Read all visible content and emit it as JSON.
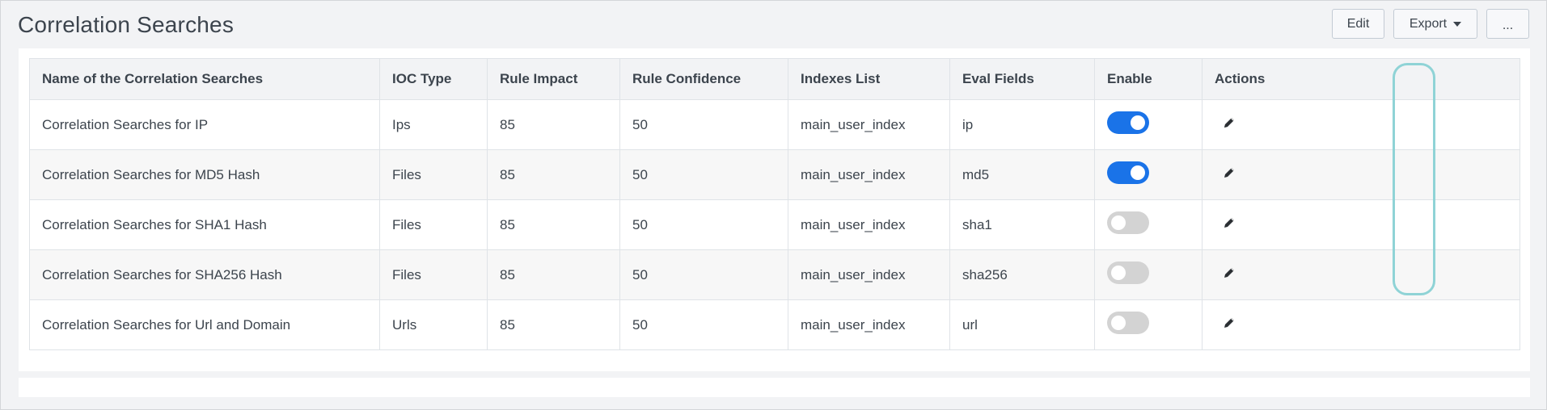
{
  "page": {
    "title": "Correlation Searches"
  },
  "toolbar": {
    "edit_label": "Edit",
    "export_label": "Export",
    "more_label": "..."
  },
  "table": {
    "headers": [
      "Name of the Correlation Searches",
      "IOC Type",
      "Rule Impact",
      "Rule Confidence",
      "Indexes List",
      "Eval Fields",
      "Enable",
      "Actions"
    ],
    "rows": [
      {
        "name": "Correlation Searches for IP",
        "ioc_type": "Ips",
        "rule_impact": "85",
        "rule_confidence": "50",
        "indexes": "main_user_index",
        "eval_fields": "ip",
        "enabled": true,
        "action_icon": "pencil-icon"
      },
      {
        "name": "Correlation Searches for MD5 Hash",
        "ioc_type": "Files",
        "rule_impact": "85",
        "rule_confidence": "50",
        "indexes": "main_user_index",
        "eval_fields": "md5",
        "enabled": true,
        "action_icon": "pencil-icon"
      },
      {
        "name": "Correlation Searches for SHA1 Hash",
        "ioc_type": "Files",
        "rule_impact": "85",
        "rule_confidence": "50",
        "indexes": "main_user_index",
        "eval_fields": "sha1",
        "enabled": false,
        "action_icon": "pencil-icon"
      },
      {
        "name": "Correlation Searches for SHA256 Hash",
        "ioc_type": "Files",
        "rule_impact": "85",
        "rule_confidence": "50",
        "indexes": "main_user_index",
        "eval_fields": "sha256",
        "enabled": false,
        "action_icon": "pencil-icon"
      },
      {
        "name": "Correlation Searches for Url and Domain",
        "ioc_type": "Urls",
        "rule_impact": "85",
        "rule_confidence": "50",
        "indexes": "main_user_index",
        "eval_fields": "url",
        "enabled": false,
        "action_icon": "pencil-icon"
      }
    ]
  },
  "colors": {
    "toggle_on": "#1a73e8",
    "toggle_off": "#d3d3d3",
    "highlight": "#8fd3d6"
  }
}
